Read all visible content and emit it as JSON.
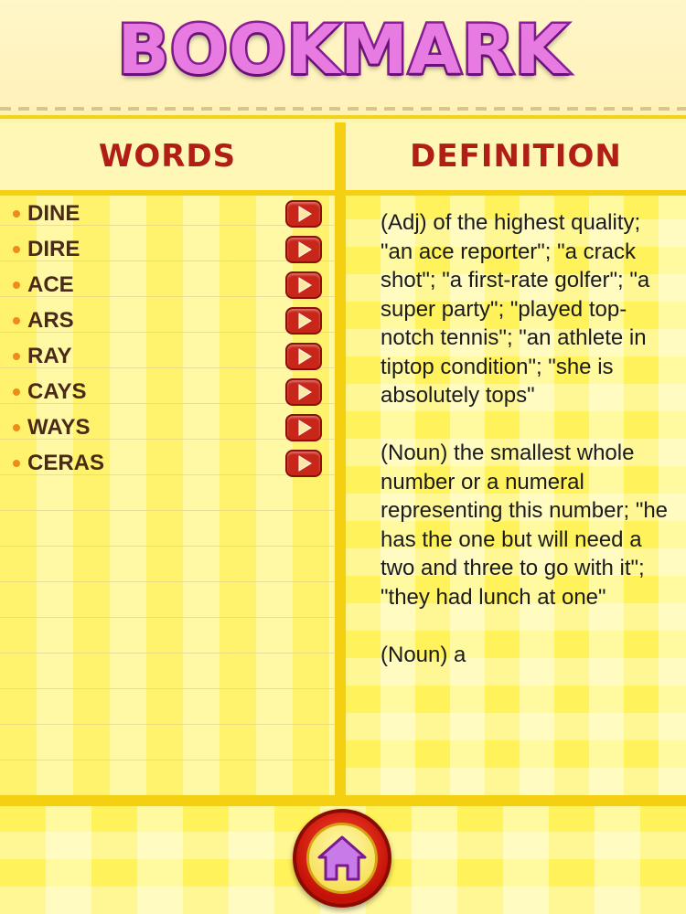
{
  "header": {
    "title": "BOOKMARK"
  },
  "columns": {
    "words_title": "WORDS",
    "definition_title": "DEFINITION"
  },
  "words": [
    {
      "label": "DINE"
    },
    {
      "label": "DIRE"
    },
    {
      "label": "ACE"
    },
    {
      "label": "ARS"
    },
    {
      "label": "RAY"
    },
    {
      "label": "CAYS"
    },
    {
      "label": "WAYS"
    },
    {
      "label": "CERAS"
    }
  ],
  "definition": {
    "text": "(Adj) of the highest quality; \"an ace reporter\"; \"a crack shot\"; \"a first-rate golfer\"; \"a super party\"; \"played top-notch tennis\"; \"an athlete in tiptop condition\"; \"she is absolutely tops\"\n\n(Noun) the smallest whole number or a numeral representing this number; \"he has the one but will need a two and three to go with it\"; \"they had lunch at one\"\n\n(Noun) a"
  },
  "icons": {
    "play": "play-icon",
    "home": "home-icon"
  },
  "colors": {
    "title_fill": "#e77be2",
    "title_stroke": "#8a1f9a",
    "header_text": "#b01e16",
    "word_text": "#4a2a17",
    "bullet": "#f08a1a",
    "play_button": "#c9261a",
    "home_button": "#c41208",
    "home_icon": "#c77ae8",
    "divider": "#f4cf12"
  }
}
